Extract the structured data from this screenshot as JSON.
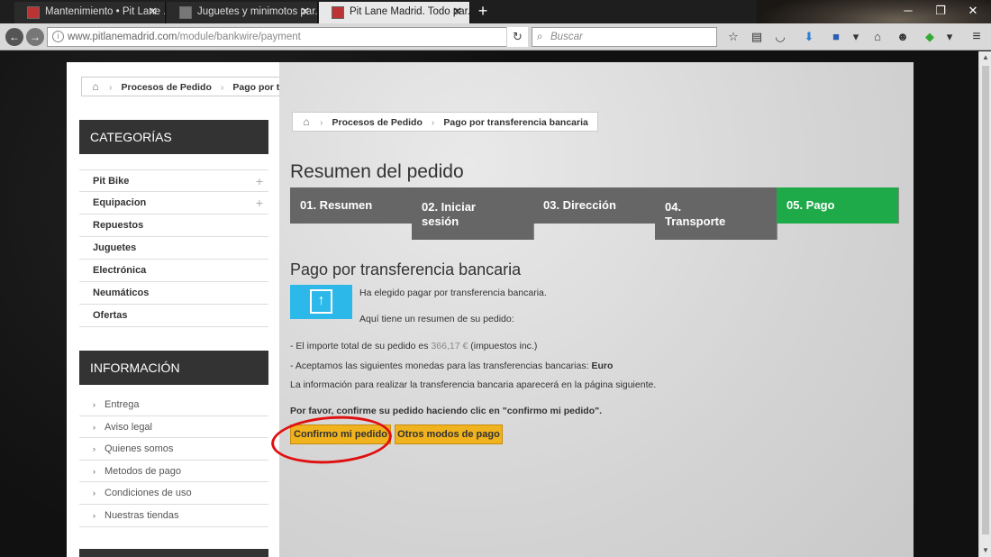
{
  "browser": {
    "tabs": [
      {
        "label": "Mantenimiento • Pit Lane ...",
        "active": false
      },
      {
        "label": "Juguetes y minimotos par...",
        "active": false
      },
      {
        "label": "Pit Lane Madrid. Todo par...",
        "active": true
      }
    ],
    "url_host": "www.pitlanemadrid.com",
    "url_path": "/module/bankwire/payment",
    "search_placeholder": "Buscar"
  },
  "outer_breadcrumb": {
    "items": [
      "Procesos de Pedido",
      "Pago por transferencia bancaria"
    ]
  },
  "sidebar": {
    "categories_title": "CATEGORÍAS",
    "categories": [
      {
        "label": "Pit Bike",
        "expandable": true
      },
      {
        "label": "Equipacion",
        "expandable": true
      },
      {
        "label": "Repuestos",
        "expandable": false
      },
      {
        "label": "Juguetes",
        "expandable": false
      },
      {
        "label": "Electrónica",
        "expandable": false
      },
      {
        "label": "Neumáticos",
        "expandable": false
      },
      {
        "label": "Ofertas",
        "expandable": false
      }
    ],
    "info_title": "INFORMACIÓN",
    "info_links": [
      "Entrega",
      "Aviso legal",
      "Quienes somos",
      "Metodos de pago",
      "Condiciones de uso",
      "Nuestras tiendas"
    ]
  },
  "main": {
    "breadcrumb": [
      "Procesos de Pedido",
      "Pago por transferencia bancaria"
    ],
    "heading": "Resumen del pedido",
    "steps": [
      {
        "line1": "01. Resumen",
        "line2": "",
        "active": false
      },
      {
        "line1": "02. Iniciar",
        "line2": "sesión",
        "active": false
      },
      {
        "line1": "03. Dirección",
        "line2": "",
        "active": false
      },
      {
        "line1": "04.",
        "line2": "Transporte",
        "active": false
      },
      {
        "line1": "05. Pago",
        "line2": "",
        "active": true
      }
    ],
    "payment_title": "Pago por transferencia bancaria",
    "chosen_text": "Ha elegido pagar por transferencia bancaria.",
    "summary_text": "Aquí tiene un resumen de su pedido:",
    "total_prefix": "- El importe total de su pedido es",
    "total_amount": "366,17 €",
    "total_suffix": "(impuestos inc.)",
    "currency_prefix": "- Aceptamos las siguientes monedas para las transferencias bancarias:",
    "currency": "Euro",
    "info_next": "La información para realizar la transferencia bancaria aparecerá en la página siguiente.",
    "confirm_prompt": "Por favor, confirme su pedido haciendo clic en \"confirmo mi pedido\".",
    "confirm_button": "Confirmo mi pedido",
    "other_button": "Otros modos de pago"
  },
  "colors": {
    "accent_green": "#1faa4a",
    "button_orange": "#f0b21d",
    "annotation_red": "#e01010",
    "bank_blue": "#2cb8e8"
  }
}
